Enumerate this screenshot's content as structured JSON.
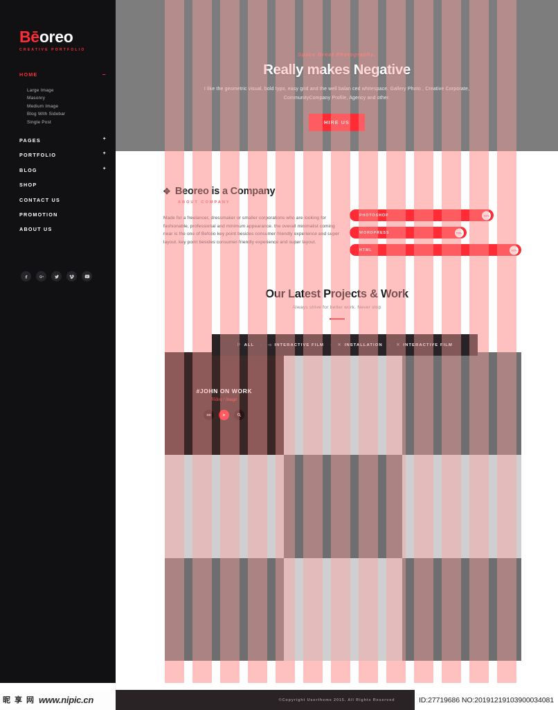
{
  "sidebar": {
    "logo": {
      "prefix": "Bē",
      "rest": "oreo",
      "tagline": "CREATIVE PORTFOLIO"
    },
    "active_section": {
      "label": "HOME",
      "toggle": "–"
    },
    "sub_items": [
      {
        "label": "Large Image"
      },
      {
        "label": "Masonry"
      },
      {
        "label": "Medium Image"
      },
      {
        "label": "Blog With Sidebar"
      },
      {
        "label": "Single Post"
      }
    ],
    "items": [
      {
        "label": "PAGES",
        "expandable": "+"
      },
      {
        "label": "PORTFOLIO",
        "expandable": "+"
      },
      {
        "label": "BLOG",
        "expandable": "+"
      },
      {
        "label": "SHOP",
        "expandable": ""
      },
      {
        "label": "CONTACT US",
        "expandable": ""
      },
      {
        "label": "PROMOTION",
        "expandable": ""
      },
      {
        "label": "ABOUT US",
        "expandable": ""
      }
    ],
    "socials": [
      {
        "name": "facebook-icon"
      },
      {
        "name": "google-plus-icon"
      },
      {
        "name": "twitter-icon"
      },
      {
        "name": "vimeo-icon"
      },
      {
        "name": "youtube-icon"
      }
    ]
  },
  "hero": {
    "eyebrow": "Space Great Photography.",
    "title": "Really makes Negative",
    "description": "I like the geometric visual, bold typo, easy grid and the well balan ced whitespace. Gallery Photo , Creative Corporate, CommunityCompany Profile, Agency and other.",
    "cta": "HIRE US"
  },
  "about": {
    "heading": "Beoreo is a Company",
    "mark": "✥",
    "subheading": "ABOUT COMPANY",
    "body": "Made for a freelancer, dressmaker or smaller corporations who are looking for fashionable, professional and minimum appearance. the overall minimalist coming near is the one of Befolio key point besides consumer-friendly experience and super layout. key point besides consumer-friendly experience and super layout.",
    "skills": [
      {
        "name": "PHOTOSHOP",
        "value": 62,
        "label": "62%"
      },
      {
        "name": "WORDPRESS",
        "value": 53,
        "label": "53%"
      },
      {
        "name": "HTML",
        "value": 92,
        "label": "92%"
      }
    ]
  },
  "projects": {
    "title": "Our Latest Projects & Work",
    "subtitle": "Always strive for better work. Never stop",
    "filters": [
      {
        "label": "ALL",
        "icon": "⚐",
        "separator": "›"
      },
      {
        "label": "INTERACTIVE FILM",
        "icon": "◅",
        "separator": "›"
      },
      {
        "label": "INSTALLATION",
        "icon": "✕",
        "separator": "›"
      },
      {
        "label": "INTERACTIVE FILM",
        "icon": "✕",
        "separator": ""
      }
    ],
    "featured_tile": {
      "name": "#JOHN ON WORK",
      "category": "Video / image",
      "actions": [
        {
          "name": "link-icon"
        },
        {
          "name": "play-icon"
        },
        {
          "name": "search-icon"
        }
      ]
    },
    "tiles": [
      {
        "tone": "dark"
      },
      {
        "tone": "light"
      },
      {
        "tone": "dark"
      },
      {
        "tone": "light"
      },
      {
        "tone": "dark"
      },
      {
        "tone": "light"
      },
      {
        "tone": "dark"
      },
      {
        "tone": "light"
      },
      {
        "tone": "dark"
      }
    ]
  },
  "footer": {
    "copyright": "©Copyright Usertheme 2015. All Rights Reserved",
    "id_text": "ID:27719686 NO:20191219103900034081"
  },
  "watermark": {
    "cjk": [
      "昵",
      "享",
      "网"
    ],
    "url": "www.nipic.cn"
  },
  "colors": {
    "accent": "#ff2b35",
    "sidebar_bg": "#111113",
    "stripe": "#ffd7d7",
    "dark_panel": "#2a2326"
  }
}
